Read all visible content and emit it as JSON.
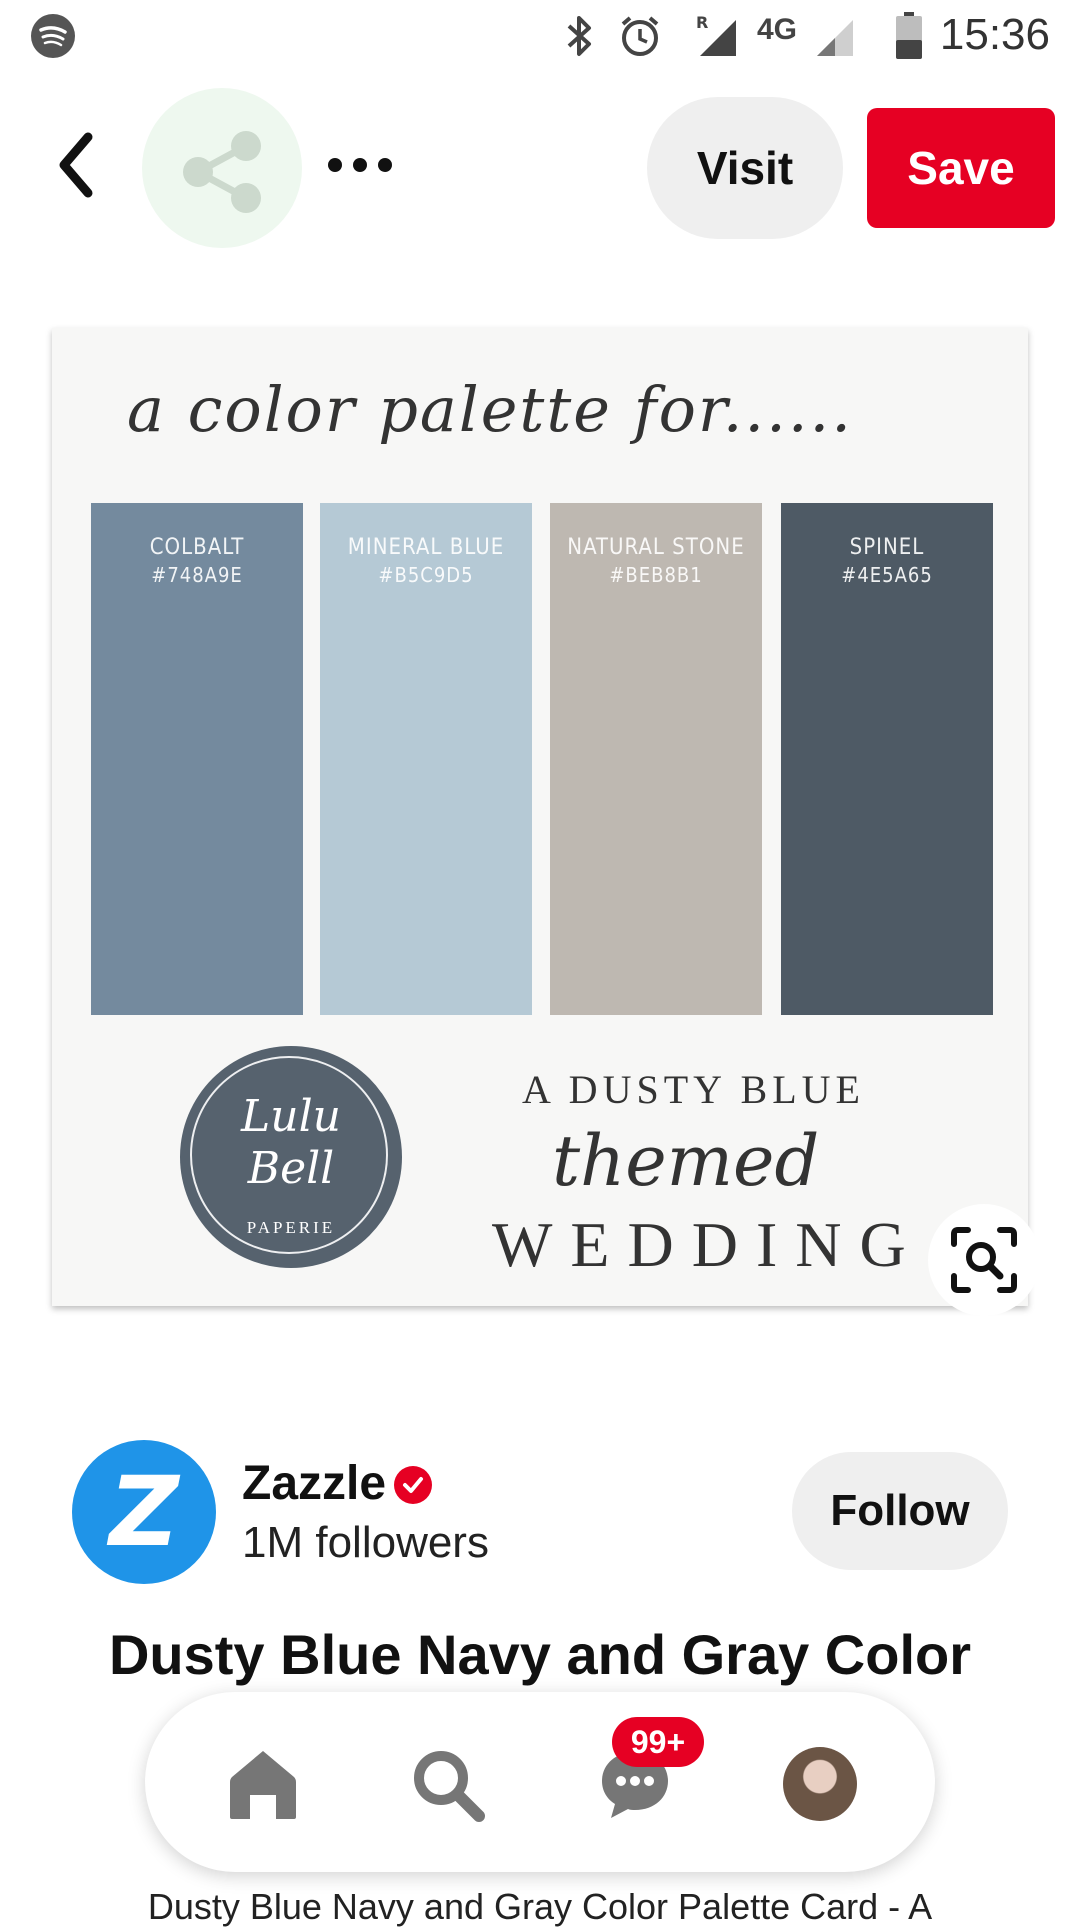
{
  "status_bar": {
    "time": "15:36",
    "network": "4G",
    "roaming": "R",
    "icons": [
      "spotify-icon",
      "bluetooth-icon",
      "alarm-icon",
      "signal-icon",
      "signal-weak-icon",
      "battery-icon"
    ]
  },
  "header": {
    "visit_label": "Visit",
    "save_label": "Save",
    "icons": [
      "back-icon",
      "share-icon",
      "more-icon"
    ]
  },
  "pin_image": {
    "heading": "a color palette for......",
    "swatches": [
      {
        "name": "COLBALT",
        "hex_label": "#748A9E",
        "color": "#748A9E"
      },
      {
        "name": "MINERAL BLUE",
        "hex_label": "#B5C9D5",
        "color": "#B5C9D5"
      },
      {
        "name": "NATURAL STONE",
        "hex_label": "#BEB8B1",
        "color": "#BEB8B1"
      },
      {
        "name": "SPINEL",
        "hex_label": "#4E5A65",
        "color": "#4E5A65"
      }
    ],
    "logo": {
      "line1": "Lulu",
      "line2": "Bell",
      "sub": "PAPERIE"
    },
    "tagline": {
      "line1": "A DUSTY BLUE",
      "line2": "themed",
      "line3": "WEDDING"
    }
  },
  "creator": {
    "name": "Zazzle",
    "followers": "1M followers",
    "follow_label": "Follow",
    "avatar_letter": "Z",
    "avatar_color": "#1f94e8"
  },
  "pin": {
    "title": "Dusty Blue Navy and Gray Color",
    "description_peek": "Dusty Blue Navy and Gray Color Palette Card - A"
  },
  "bottom_nav": {
    "badge": "99+",
    "items": [
      "home-icon",
      "search-icon",
      "messages-icon",
      "profile-avatar"
    ]
  },
  "colors": {
    "brand_red": "#e60023",
    "button_gray": "#efefef"
  }
}
